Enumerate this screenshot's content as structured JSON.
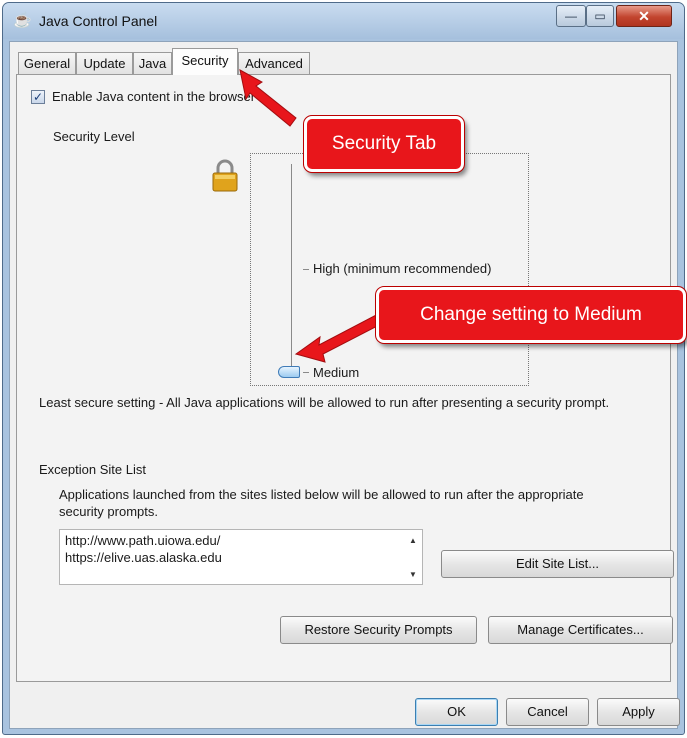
{
  "window": {
    "title": "Java Control Panel",
    "minimize_glyph": "—",
    "maximize_glyph": "▭",
    "close_glyph": "✕",
    "icon": "java-cup-icon"
  },
  "tabs": [
    {
      "label": "General"
    },
    {
      "label": "Update"
    },
    {
      "label": "Java"
    },
    {
      "label": "Security",
      "active": true
    },
    {
      "label": "Advanced"
    }
  ],
  "security": {
    "enable_checkbox_label": "Enable Java content in the browser",
    "enable_checked": true,
    "security_level_label": "Security Level",
    "levels": {
      "high": "High (minimum recommended)",
      "medium": "Medium"
    },
    "selected_level": "Medium",
    "level_description": "Least secure setting - All Java applications will be allowed to run after presenting a security prompt."
  },
  "exception_site_list": {
    "heading": "Exception Site List",
    "description_line1": "Applications launched from the sites listed below will be allowed to run after the appropriate",
    "description_line2": "security prompts.",
    "sites": [
      "http://www.path.uiowa.edu/",
      "https://elive.uas.alaska.edu"
    ],
    "edit_button": "Edit Site List..."
  },
  "buttons": {
    "restore_prompts": "Restore Security Prompts",
    "manage_certificates": "Manage Certificates...",
    "ok": "OK",
    "cancel": "Cancel",
    "apply": "Apply"
  },
  "annotations": {
    "security_tab_callout": "Security Tab",
    "medium_callout": "Change setting to Medium",
    "color": "#e8161b"
  }
}
